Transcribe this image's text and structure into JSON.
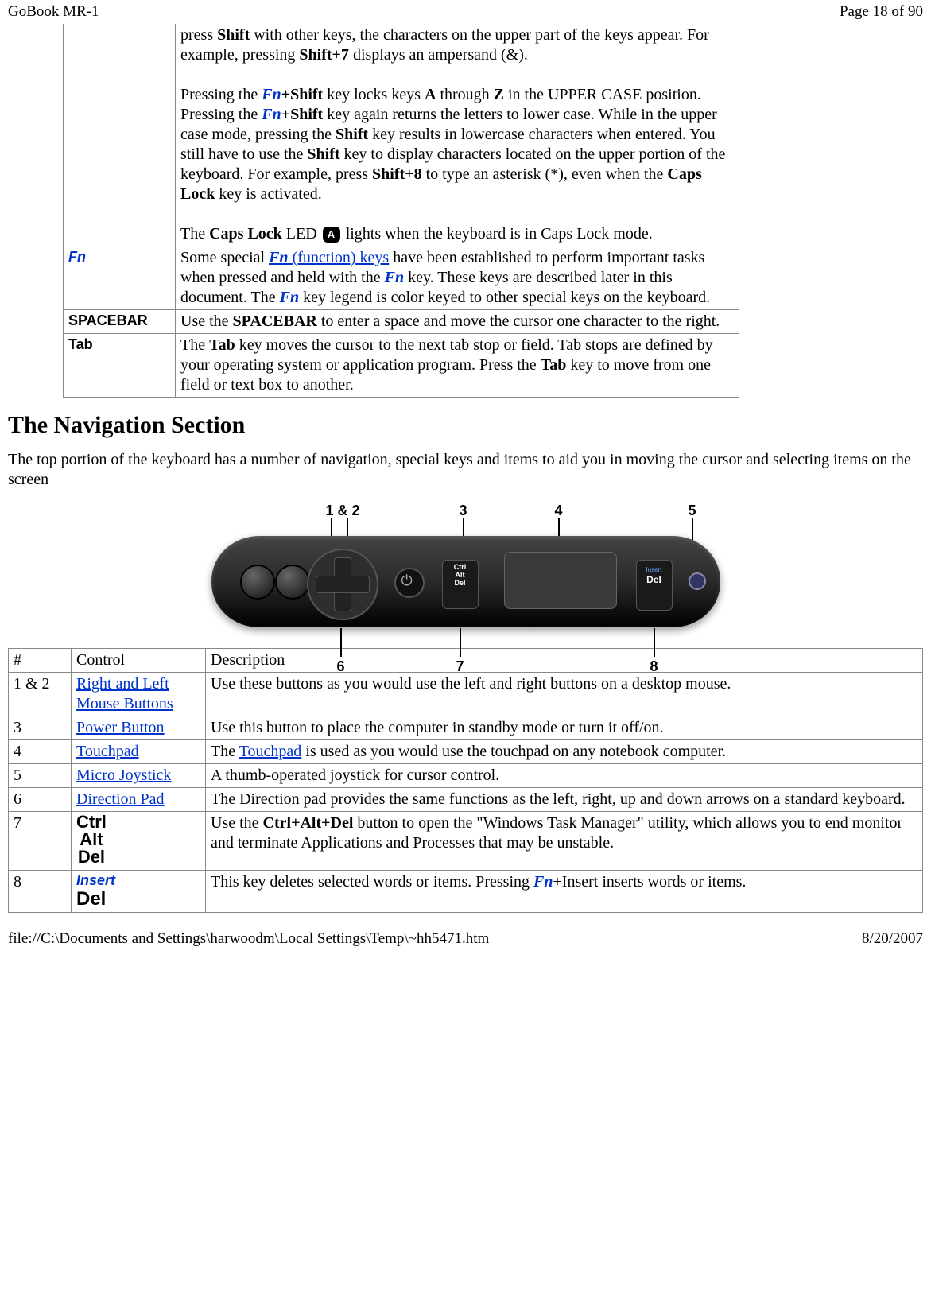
{
  "header": {
    "title": "GoBook MR-1",
    "page": "Page 18 of 90"
  },
  "t1": {
    "shift": {
      "p1a": "press ",
      "p1b": " with other keys, the characters on the upper part of the keys appear. For example, pressing ",
      "p1c": " displays an ampersand (&).",
      "p2a": "Pressing the ",
      "p2b": " key locks keys ",
      "p2c": " through ",
      "p2d": " in the UPPER CASE position. Pressing the ",
      "p2e": " key again returns the letters to lower case. While in the upper case mode, pressing the ",
      "p2f": " key results in lowercase characters when entered. You still have to use the ",
      "p2g": " key to display characters located on the upper portion of the keyboard. For example, press ",
      "p2h": " to type an asterisk (*), even when the ",
      "p2i": " key is activated.",
      "p3a": "The ",
      "p3b": " LED ",
      "p3c": " lights when the keyboard is in Caps Lock mode.",
      "k_shift": "Shift",
      "k_shift7": "Shift+7",
      "k_fn": "Fn",
      "k_plus_shift": "+Shift",
      "k_A": "A",
      "k_Z": "Z",
      "k_shift8": "Shift+8",
      "k_caps": "Caps Lock"
    },
    "fn": {
      "label": "Fn",
      "a": "Some special ",
      "link": " (function) keys",
      "fnword": "Fn",
      "b": " have been established to perform important tasks when pressed and held with the ",
      "c": " key. These keys are described later in this document.  The ",
      "d": " key legend is color keyed to other special keys on the keyboard."
    },
    "space": {
      "label": "SPACEBAR",
      "a": "Use the ",
      "k": "SPACEBAR",
      "b": " to enter a space and move the cursor one character to the right."
    },
    "tab": {
      "label": "Tab",
      "a": "The ",
      "k": "Tab",
      "b": " key moves the cursor to the next tab stop or field. Tab stops are defined by your operating system or application program. Press the ",
      "c": " key to move from one field or text box to another."
    }
  },
  "h2": "The Navigation Section",
  "intro": "The top portion of the keyboard has a number of navigation, special keys and items to aid you in moving the cursor and selecting items on the screen",
  "labels": {
    "l12": "1 & 2",
    "l3": "3",
    "l4": "4",
    "l5": "5",
    "l6": "6",
    "l7": "7",
    "l8": "8"
  },
  "t2": {
    "hdr": {
      "num": "#",
      "ctrl": "Control",
      "desc": "Description"
    },
    "r1": {
      "num": "1 & 2",
      "ctrl": "Right and Left Mouse Buttons",
      "desc": " Use these buttons as you would use the left and right buttons on a desktop mouse."
    },
    "r2": {
      "num": "3",
      "ctrl": "Power Button",
      "desc": "Use this button to place the computer in standby mode or turn it off/on."
    },
    "r3": {
      "num": "4",
      "ctrl": "Touchpad",
      "a": "The ",
      "link": "Touchpad",
      "b": " is used as you would use the touchpad on any notebook computer."
    },
    "r4": {
      "num": "5",
      "ctrl": "Micro Joystick",
      "desc": "A thumb-operated joystick for cursor control."
    },
    "r5": {
      "num": "6",
      "ctrl": "Direction Pad",
      "desc": "The Direction pad provides the same functions as the left, right, up and down arrows on a standard keyboard."
    },
    "r6": {
      "num": "7",
      "a": "Use the ",
      "k": "Ctrl+Alt+Del",
      "b": " button to open the \"Windows Task Manager\" utility, which allows you to end monitor and terminate Applications and Processes that may be unstable."
    },
    "r7": {
      "num": "8",
      "a": "This key deletes selected words or items.  Pressing ",
      "fn": "Fn",
      "b": "+Insert inserts words or items."
    },
    "cad": {
      "l1": "Ctrl",
      "l2": "Alt",
      "l3": "Del"
    },
    "del": {
      "ins": "Insert",
      "del": "Del"
    }
  },
  "footer": {
    "path": "file://C:\\Documents and Settings\\harwoodm\\Local Settings\\Temp\\~hh5471.htm",
    "date": "8/20/2007"
  }
}
